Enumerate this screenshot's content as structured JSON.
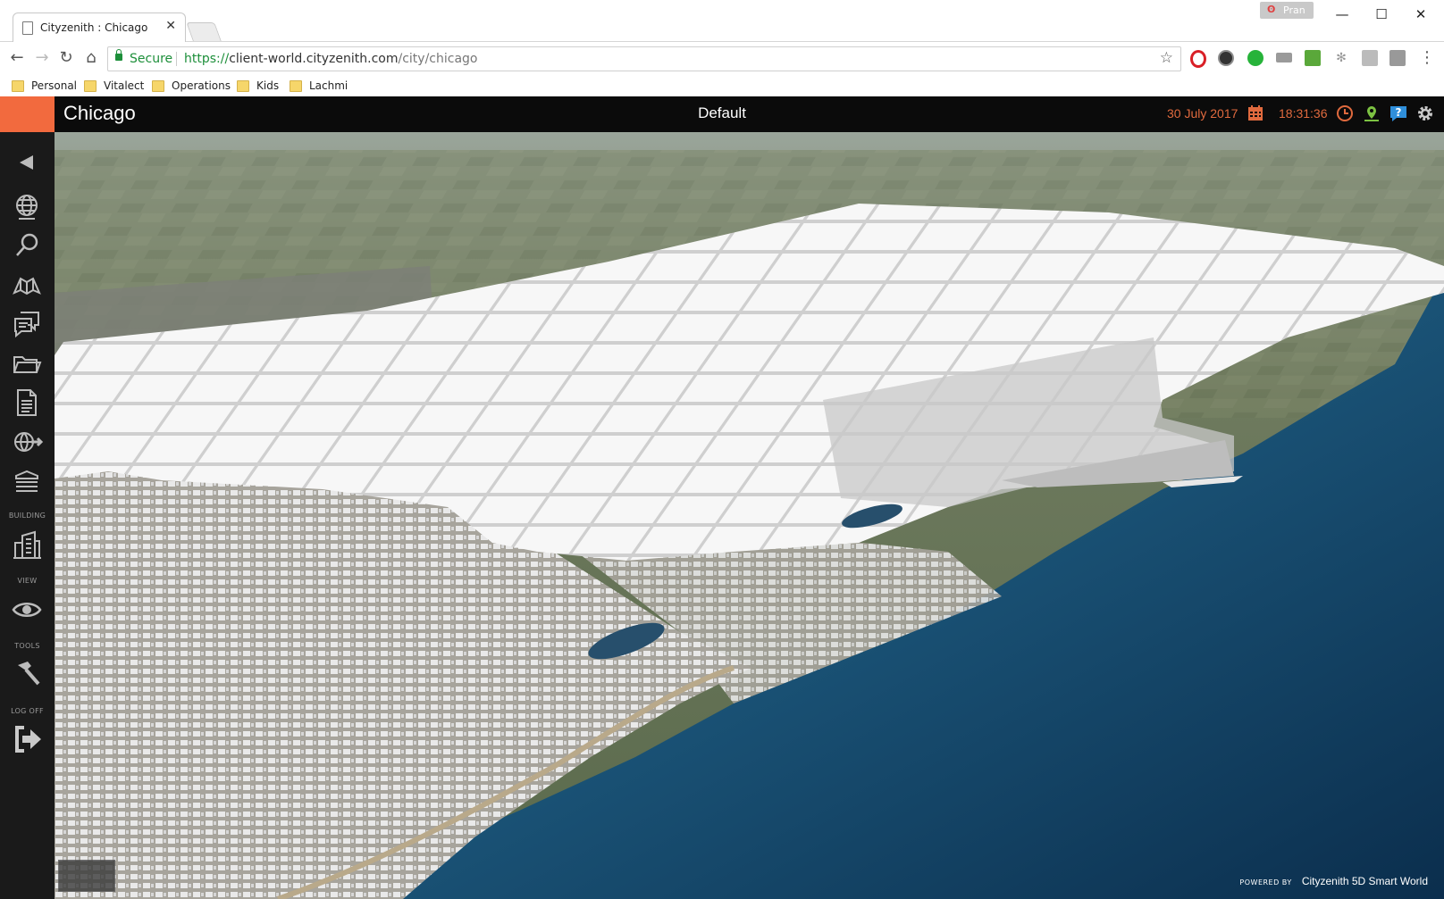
{
  "browser": {
    "tab_title": "Cityzenith : Chicago",
    "profile_name": "Pran",
    "secure_label": "Secure",
    "url_scheme": "https://",
    "url_host": "client-world.cityzenith.com",
    "url_path": "/city/chicago",
    "bookmarks": [
      "Personal",
      "Vitalect",
      "Operations",
      "Kids",
      "Lachmi"
    ]
  },
  "app": {
    "city": "Chicago",
    "scenario": "Default",
    "date": "30 July 2017",
    "time": "18:31:36",
    "accent_color": "#f26a3e"
  },
  "sidebar": {
    "items": [
      {
        "icon": "collapse-arrow-icon"
      },
      {
        "icon": "globe-icon"
      },
      {
        "icon": "search-icon"
      },
      {
        "icon": "map-book-icon"
      },
      {
        "icon": "chat-icon"
      },
      {
        "icon": "folder-icon"
      },
      {
        "icon": "document-icon"
      },
      {
        "icon": "globe-arrow-icon"
      },
      {
        "icon": "layers-icon"
      },
      {
        "icon": "buildings-icon"
      },
      {
        "icon": "eye-icon"
      },
      {
        "icon": "hammer-icon"
      },
      {
        "icon": "logout-icon"
      }
    ],
    "section_labels": {
      "building": "BUILDING",
      "view": "VIEW",
      "tools": "TOOLS",
      "logoff": "LOG OFF"
    }
  },
  "footer": {
    "powered_by": "POWERED BY",
    "product": "Cityzenith 5D Smart World"
  }
}
